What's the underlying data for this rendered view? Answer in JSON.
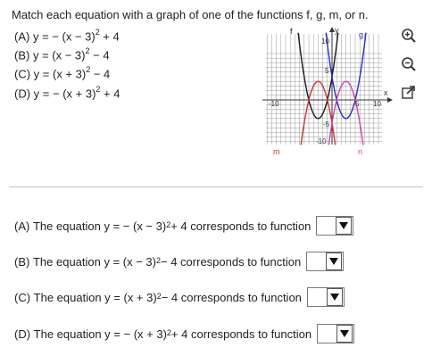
{
  "prompt": "Match each equation with a graph of one of the functions f, g, m, or n.",
  "equations": [
    {
      "label": "(A)",
      "lhs": "y = − (x − 3)",
      "exp": "2",
      "rhs": " + 4"
    },
    {
      "label": "(B)",
      "lhs": "y = (x − 3)",
      "exp": "2",
      "rhs": " − 4"
    },
    {
      "label": "(C)",
      "lhs": "y = (x + 3)",
      "exp": "2",
      "rhs": " − 4"
    },
    {
      "label": "(D)",
      "lhs": "y = − (x + 3)",
      "exp": "2",
      "rhs": " + 4"
    }
  ],
  "graph": {
    "function_labels": {
      "f": "f",
      "g": "g",
      "m": "m",
      "n": "n"
    },
    "axis_labels": {
      "x": "x",
      "y": "y"
    },
    "ticks": {
      "x_neg": "-10",
      "x_pos": "10",
      "x_mid": "5",
      "y_pos": "10",
      "y_mid": "5",
      "y_neg_mid": "-5",
      "y_neg": "-10"
    },
    "colors": {
      "f": "#1a1a1a",
      "g": "#2a2ad0",
      "m": "#cc3333",
      "n": "#cc44aa",
      "grid": "#999999"
    }
  },
  "icons": [
    "zoom-in-icon",
    "zoom-out-icon",
    "external-link-icon"
  ],
  "answers": [
    {
      "label": "(A)",
      "lhs": "The equation y = − (x − 3)",
      "exp": "2",
      "rhs": " + 4 corresponds to function",
      "selected": ""
    },
    {
      "label": "(B)",
      "lhs": "The equation y = (x − 3)",
      "exp": "2",
      "rhs": " − 4 corresponds to function",
      "selected": ""
    },
    {
      "label": "(C)",
      "lhs": "The equation y = (x + 3)",
      "exp": "2",
      "rhs": " − 4 corresponds to function",
      "selected": ""
    },
    {
      "label": "(D)",
      "lhs": "The equation y = − (x + 3)",
      "exp": "2",
      "rhs": " + 4 corresponds to function",
      "selected": ""
    }
  ]
}
